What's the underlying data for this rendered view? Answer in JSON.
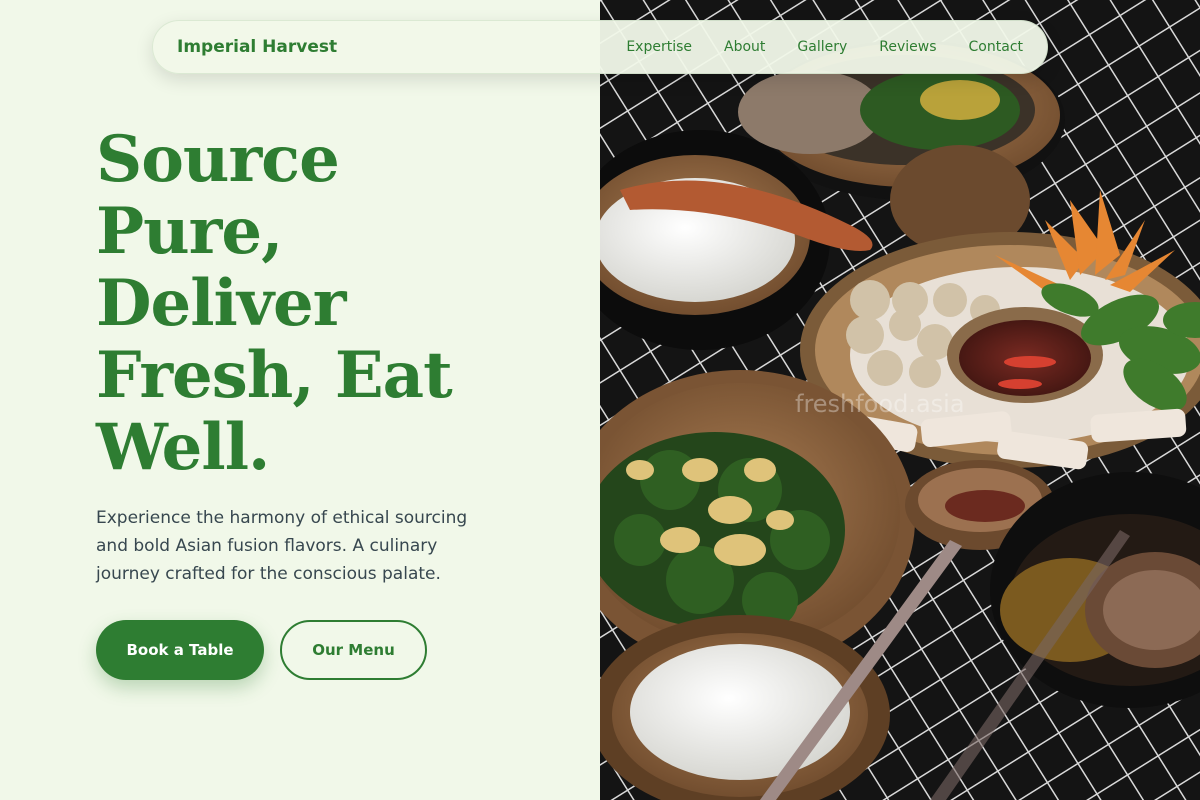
{
  "nav": {
    "brand": "Imperial Harvest",
    "links": [
      "Expertise",
      "About",
      "Gallery",
      "Reviews",
      "Contact"
    ]
  },
  "hero": {
    "headline_lines": [
      "Source",
      "Pure,",
      "Deliver",
      "Fresh, Eat",
      "Well."
    ],
    "tagline": "Experience the harmony of ethical sourcing and bold Asian fusion flavors. A culinary journey crafted for the conscious palate.",
    "primary_cta": "Book a Table",
    "secondary_cta": "Our Menu"
  },
  "image": {
    "watermark": "freshfood.asia"
  },
  "colors": {
    "background": "#f1f8e9",
    "accent": "#2e7d32",
    "text": "#37474f"
  }
}
